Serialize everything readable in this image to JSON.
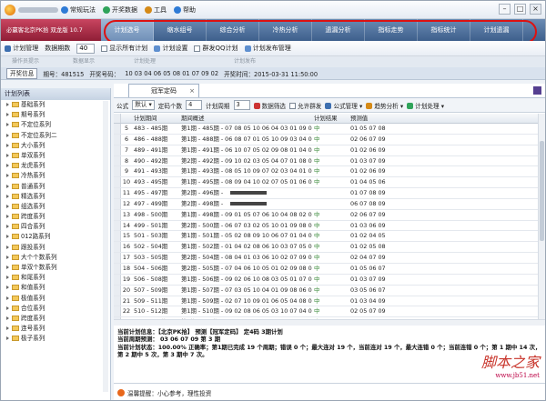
{
  "menus": [
    "常规玩法",
    "开奖数据",
    "工具",
    "帮助"
  ],
  "brand": "必赢客北京PK拾 双龙版 10.7",
  "nav_tabs": [
    "计划选号",
    "缩水组号",
    "综合分析",
    "冷热分析",
    "遗漏分析",
    "指标走势",
    "指标统计",
    "计划遗漏"
  ],
  "toolbar1": {
    "plan_mgr": "计划管理",
    "periods_label": "数据期数",
    "periods_value": "40",
    "show_all": "显示所有计划",
    "plan_settings": "计划设置",
    "bind_qq": "群发QQ计划",
    "publish_mgr": "计划发布管理"
  },
  "sections": [
    "操作员提示",
    "数据显示",
    "计划处理",
    "计划发布"
  ],
  "info": {
    "btn": "开奖信息",
    "period": "期号：481515",
    "draw_label": "开奖号码：",
    "draw_numbers": "10 03 04 06 05 08 01 07 09 02",
    "time": "开奖时间：2015-03-31 11:50:00"
  },
  "sidebar_title": "计划列表",
  "sidebar_items": [
    "基础系列",
    "期号系列",
    "不定位系列",
    "不定位系列二",
    "大小系列",
    "单双系列",
    "龙虎系列",
    "冷热系列",
    "普通系列",
    "精选系列",
    "组选系列",
    "跨度系列",
    "四合系列",
    "012路系列",
    "跟投系列",
    "大个个数系列",
    "单双个数系列",
    "和尾系列",
    "和值系列",
    "极值系列",
    "合位系列",
    "跨度系列",
    "连号系列",
    "极子系列"
  ],
  "main_tab": "冠军定码",
  "controls": {
    "formula_label": "公式",
    "formula_value": "默认",
    "code_count_label": "定码个数",
    "code_count": "4",
    "period_label": "计划周期",
    "period_value": "3",
    "filter": "数据筛选",
    "allow_dup": "允许群发",
    "formula_mgr": "公式管理",
    "trend": "趋势分析",
    "plan_proc": "计划处理"
  },
  "grid_headers": [
    "",
    "",
    "计划期间",
    "期间概述",
    "计划结果",
    "预测值"
  ],
  "rows": [
    [
      "5",
      "483 - 485期",
      "第1期 - 485期 - 07 08 05 10 06 04 03 01 09 02",
      "中",
      "01 05 07 08"
    ],
    [
      "6",
      "486 - 488期",
      "第1期 - 488期 - 06 08 07 01 05 10 09 03 04 02",
      "中",
      "02 06 07 09"
    ],
    [
      "7",
      "489 - 491期",
      "第1期 - 491期 - 06 10 07 05 02 09 08 01 04 03",
      "中",
      "01 02 06 09"
    ],
    [
      "8",
      "490 - 492期",
      "第2期 - 492期 - 09 10 02 03 05 04 07 01 08 06",
      "中",
      "01 03 07 09"
    ],
    [
      "9",
      "491 - 493期",
      "第1期 - 493期 - 08 05 10 09 07 02 03 04 01 06",
      "中",
      "01 02 06 09"
    ],
    [
      "10",
      "493 - 495期",
      "第1期 - 495期 - 08 09 04 10 02 07 05 01 06 03",
      "中",
      "01 04 05 06"
    ],
    [
      "11",
      "495 - 497期",
      "第2期 - 496期 -",
      "",
      "01 07 08 09"
    ],
    [
      "12",
      "497 - 499期",
      "第2期 - 498期 -",
      "",
      "06 07 08 09"
    ],
    [
      "13",
      "498 - 500期",
      "第1期 - 498期 - 09 01 05 07 06 10 04 08 02 03",
      "中",
      "02 06 07 09"
    ],
    [
      "14",
      "499 - 501期",
      "第2期 - 500期 - 06 07 03 02 05 10 01 09 08 04",
      "中",
      "01 03 06 09"
    ],
    [
      "15",
      "501 - 503期",
      "第1期 - 501期 - 05 02 08 09 10 06 07 01 04 03",
      "中",
      "01 02 04 05"
    ],
    [
      "16",
      "502 - 504期",
      "第1期 - 502期 - 01 04 02 08 06 10 03 07 05 09",
      "中",
      "01 02 05 08"
    ],
    [
      "17",
      "503 - 505期",
      "第2期 - 504期 - 08 04 01 03 06 10 02 07 09 05",
      "中",
      "02 04 07 09"
    ],
    [
      "18",
      "504 - 506期",
      "第2期 - 505期 - 07 04 06 10 05 01 02 09 08 03",
      "中",
      "01 05 06 07"
    ],
    [
      "19",
      "506 - 508期",
      "第1期 - 506期 - 09 02 06 10 08 03 05 01 07 04",
      "中",
      "01 03 07 09"
    ],
    [
      "20",
      "507 - 509期",
      "第1期 - 507期 - 07 03 05 10 04 01 09 08 06 02",
      "中",
      "03 05 06 07"
    ],
    [
      "21",
      "509 - 511期",
      "第1期 - 509期 - 02 07 10 09 01 06 05 04 08 03",
      "中",
      "01 03 04 09"
    ],
    [
      "22",
      "510 - 512期",
      "第1期 - 510期 - 09 02 08 06 05 03 10 07 04 01",
      "中",
      "02 05 07 09"
    ],
    [
      "23",
      "511 - 513期",
      "第1期 - 512期 - 01 04 09 03 10 02 08 06 07 05",
      "中",
      "01 02 07 09"
    ],
    [
      "24",
      "513 - 515期",
      "第1期 - 515期 - 02 06 10 04 01 05 09 07 08 03",
      "中",
      "02 06 07 09"
    ],
    [
      "25",
      "514 - 516期",
      "第1期 - 516期进行中...",
      "等开",
      "01 06 07 09"
    ]
  ],
  "bottom": {
    "line1": "当前计划信息：【北京PK拾】 预测【冠军定码】 定4码 3期计划",
    "line2": "当前周期预测： 03 06 07 09  第 3 期",
    "line3": "当前计划状态：100.00% 正确率；第1期已完成 19 个周期；错误 0 个；最大连对 19 个，当前连对 19 个，最大连错 0 个；当前连错 0 个；第 1 期中 14 次，第 2 期中 5 次，第 3 期中 7 次。"
  },
  "tip": "温馨提醒：小心参考，理性投资",
  "watermark": {
    "big": "脚本之家",
    "url": "www.jb51.net"
  }
}
